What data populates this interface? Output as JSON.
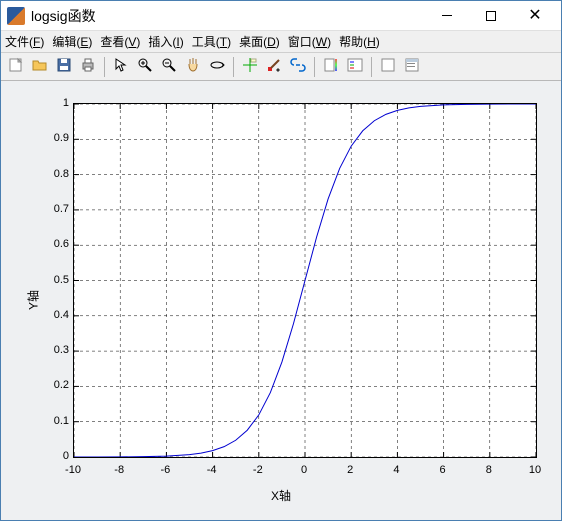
{
  "window": {
    "title": "logsig函数",
    "controls": {
      "min": "minimize",
      "max": "maximize",
      "close": "close"
    }
  },
  "menu": {
    "items": [
      {
        "label": "文件",
        "mn": "F"
      },
      {
        "label": "编辑",
        "mn": "E"
      },
      {
        "label": "查看",
        "mn": "V"
      },
      {
        "label": "插入",
        "mn": "I"
      },
      {
        "label": "工具",
        "mn": "T"
      },
      {
        "label": "桌面",
        "mn": "D"
      },
      {
        "label": "窗口",
        "mn": "W"
      },
      {
        "label": "帮助",
        "mn": "H"
      }
    ]
  },
  "toolbar": {
    "buttons": [
      "new-figure",
      "open",
      "save",
      "print",
      "|",
      "arrow",
      "zoom-in",
      "zoom-out",
      "pan",
      "rotate-3d",
      "|",
      "data-cursor",
      "brush",
      "link",
      "|",
      "colorbar",
      "legend",
      "|",
      "hide-tools",
      "show-tools"
    ]
  },
  "chart_data": {
    "type": "line",
    "title": "",
    "xlabel": "X轴",
    "ylabel": "Y轴",
    "xlim": [
      -10,
      10
    ],
    "ylim": [
      0,
      1
    ],
    "xticks": [
      -10,
      -8,
      -6,
      -4,
      -2,
      0,
      2,
      4,
      6,
      8,
      10
    ],
    "yticks": [
      0,
      0.1,
      0.2,
      0.3,
      0.4,
      0.5,
      0.6,
      0.7,
      0.8,
      0.9,
      1
    ],
    "grid": true,
    "line_color": "#0000d0",
    "series": [
      {
        "name": "logsig",
        "x": [
          -10,
          -9,
          -8,
          -7,
          -6,
          -5,
          -4.5,
          -4,
          -3.5,
          -3,
          -2.5,
          -2,
          -1.5,
          -1,
          -0.5,
          0,
          0.5,
          1,
          1.5,
          2,
          2.5,
          3,
          3.5,
          4,
          4.5,
          5,
          6,
          7,
          8,
          9,
          10
        ],
        "y": [
          5e-05,
          0.00012,
          0.00034,
          0.00091,
          0.00247,
          0.00669,
          0.01099,
          0.01799,
          0.02931,
          0.04743,
          0.07586,
          0.1192,
          0.18243,
          0.26894,
          0.37754,
          0.5,
          0.62246,
          0.73106,
          0.81757,
          0.8808,
          0.92414,
          0.95257,
          0.97069,
          0.98201,
          0.98901,
          0.99331,
          0.99753,
          0.99909,
          0.99966,
          0.99988,
          0.99995
        ]
      }
    ]
  }
}
